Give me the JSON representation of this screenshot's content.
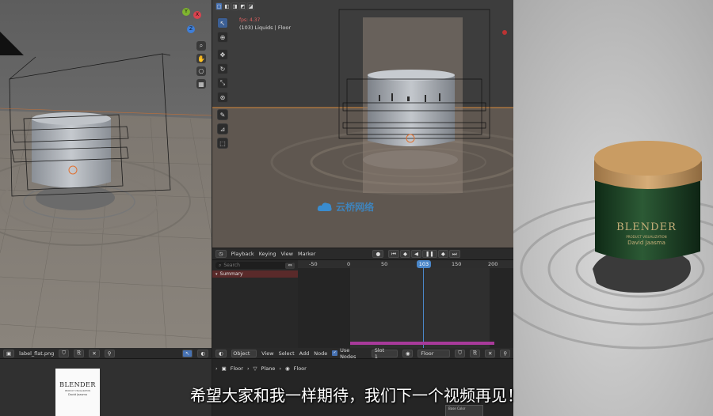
{
  "left_viewport": {
    "gizmo": {
      "x": "X",
      "y": "Y",
      "z": "Z"
    }
  },
  "center_viewport": {
    "fps": "fps: 4.37",
    "object_info": "(103) Liquids | Floor",
    "watermark": "云桥网络"
  },
  "image_editor": {
    "image_name": "label_flat.png",
    "label_brand": "BLENDER",
    "label_sub1": "PRODUCT VISUALIZATION",
    "label_sub2": "David Jaasma"
  },
  "timeline": {
    "menus": [
      "Playback",
      "Keying",
      "View",
      "Marker"
    ],
    "search_placeholder": "Search",
    "current_frame": "103",
    "ticks": [
      "-50",
      "0",
      "50",
      "103",
      "150",
      "200"
    ],
    "channel": "Summary"
  },
  "node_editor": {
    "mode": "Object",
    "menus": [
      "View",
      "Select",
      "Add",
      "Node"
    ],
    "use_nodes_label": "Use Nodes",
    "use_nodes": true,
    "slot": "Slot 1",
    "material": "Floor",
    "breadcrumb": [
      "Floor",
      "Plane",
      "Floor"
    ],
    "node_label": "Base Color"
  },
  "render": {
    "brand": "BLENDER",
    "sub": "PRODUCT VISUALIZATION",
    "author": "David Jaasma"
  },
  "subtitle": "希望大家和我一样期待，我们下一个视频再见！",
  "colors": {
    "accent_blue": "#4772b3",
    "frame_marker": "#4a86c8",
    "summary_bg": "#5a2a2a",
    "jar_green": "#1f4a2a",
    "lid_wood": "#c9a06a",
    "playhead_keys": "#a83a9a"
  }
}
